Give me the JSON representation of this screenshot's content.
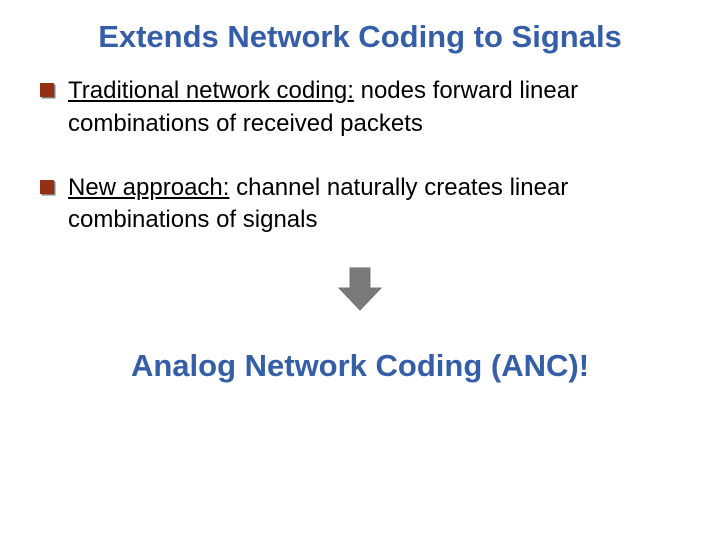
{
  "title": {
    "text": "Extends Network Coding to Signals",
    "color": "#355EA9"
  },
  "bullets": [
    {
      "lead": "Traditional network coding:",
      "rest": " nodes forward linear combinations of received packets"
    },
    {
      "lead": "New approach:",
      "rest": " channel naturally creates linear combinations of signals"
    }
  ],
  "arrow": {
    "name": "down-arrow",
    "fill": "#7A7A7A"
  },
  "conclusion": {
    "text": "Analog Network Coding (ANC)!",
    "color": "#355EA9"
  }
}
